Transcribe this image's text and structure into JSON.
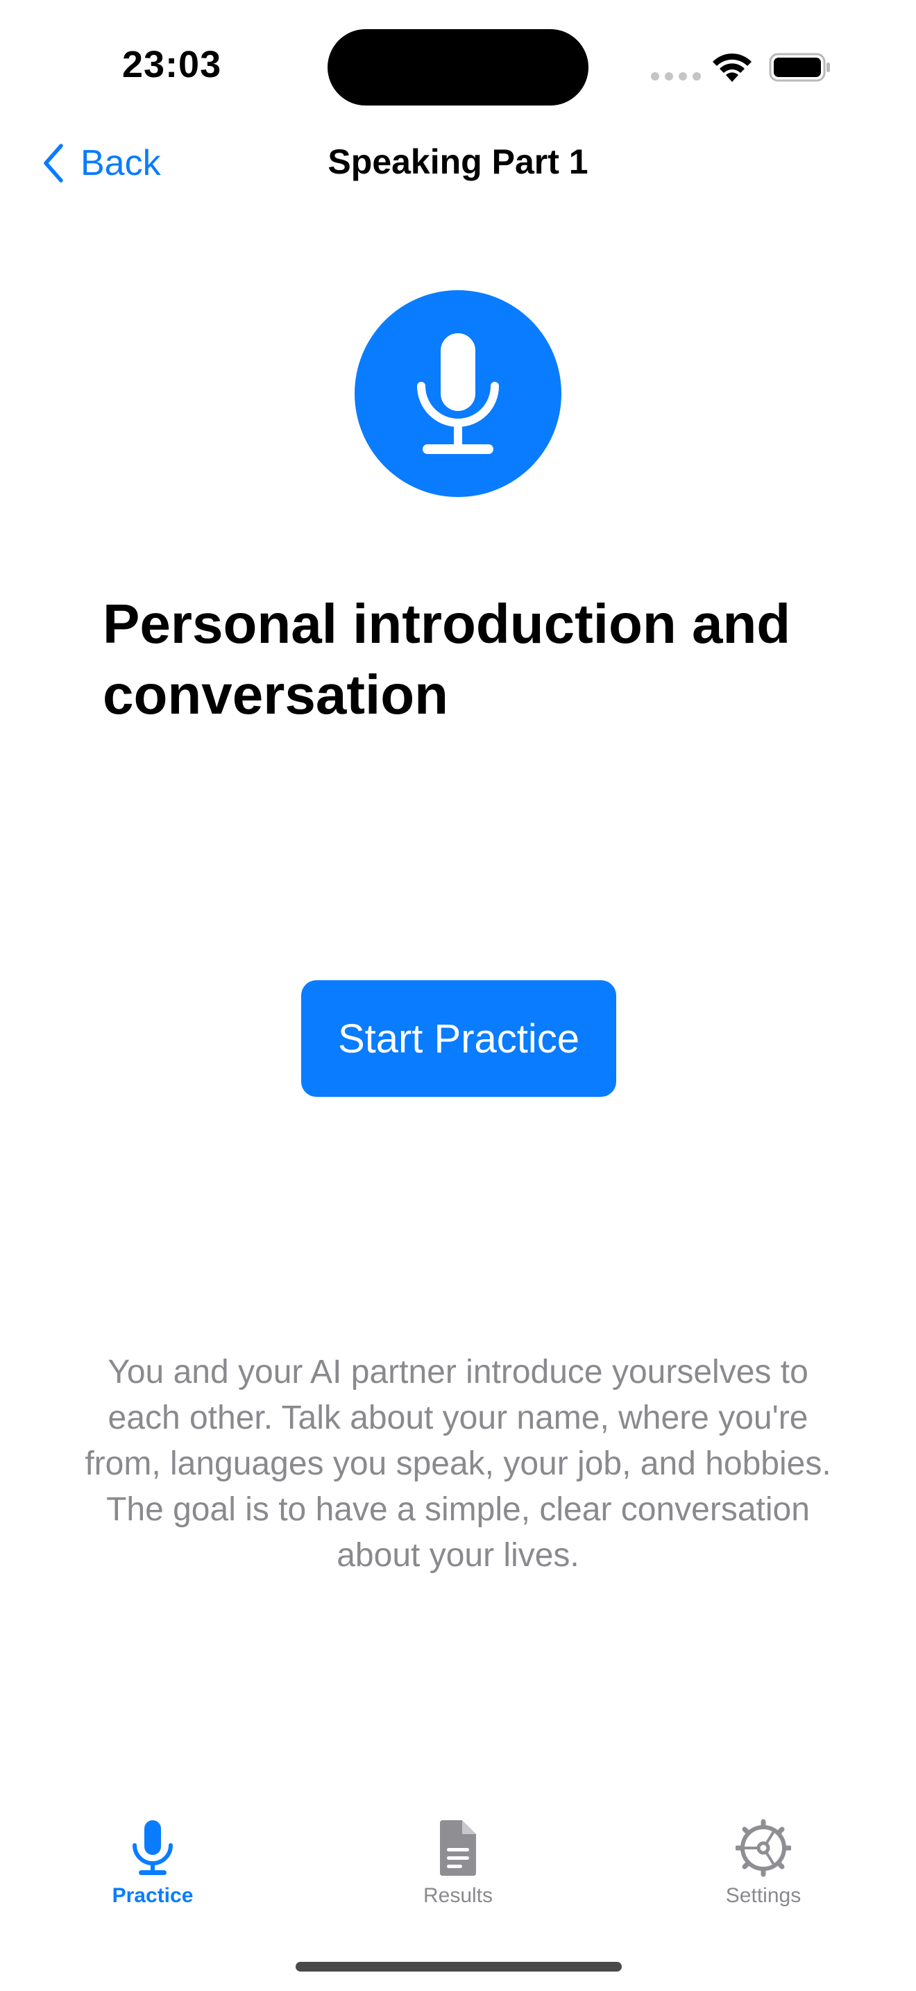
{
  "status_bar": {
    "time": "23:03"
  },
  "nav": {
    "back_label": "Back",
    "title": "Speaking Part 1"
  },
  "hero": {
    "icon": "microphone-icon",
    "heading": "Personal introduction and conversation"
  },
  "start_button_label": "Start Practice",
  "description": "You and your AI partner introduce yourselves to each other. Talk about your name, where you're from, languages you speak, your job, and hobbies. The goal is to have a simple, clear conversation about your lives.",
  "tabs": [
    {
      "label": "Practice",
      "icon": "microphone-icon",
      "active": true
    },
    {
      "label": "Results",
      "icon": "document-icon",
      "active": false
    },
    {
      "label": "Settings",
      "icon": "gear-icon",
      "active": false
    }
  ],
  "colors": {
    "accent": "#0A7CFF",
    "secondary_text": "#8A8A8E",
    "inactive_icon": "#8E8E93"
  }
}
